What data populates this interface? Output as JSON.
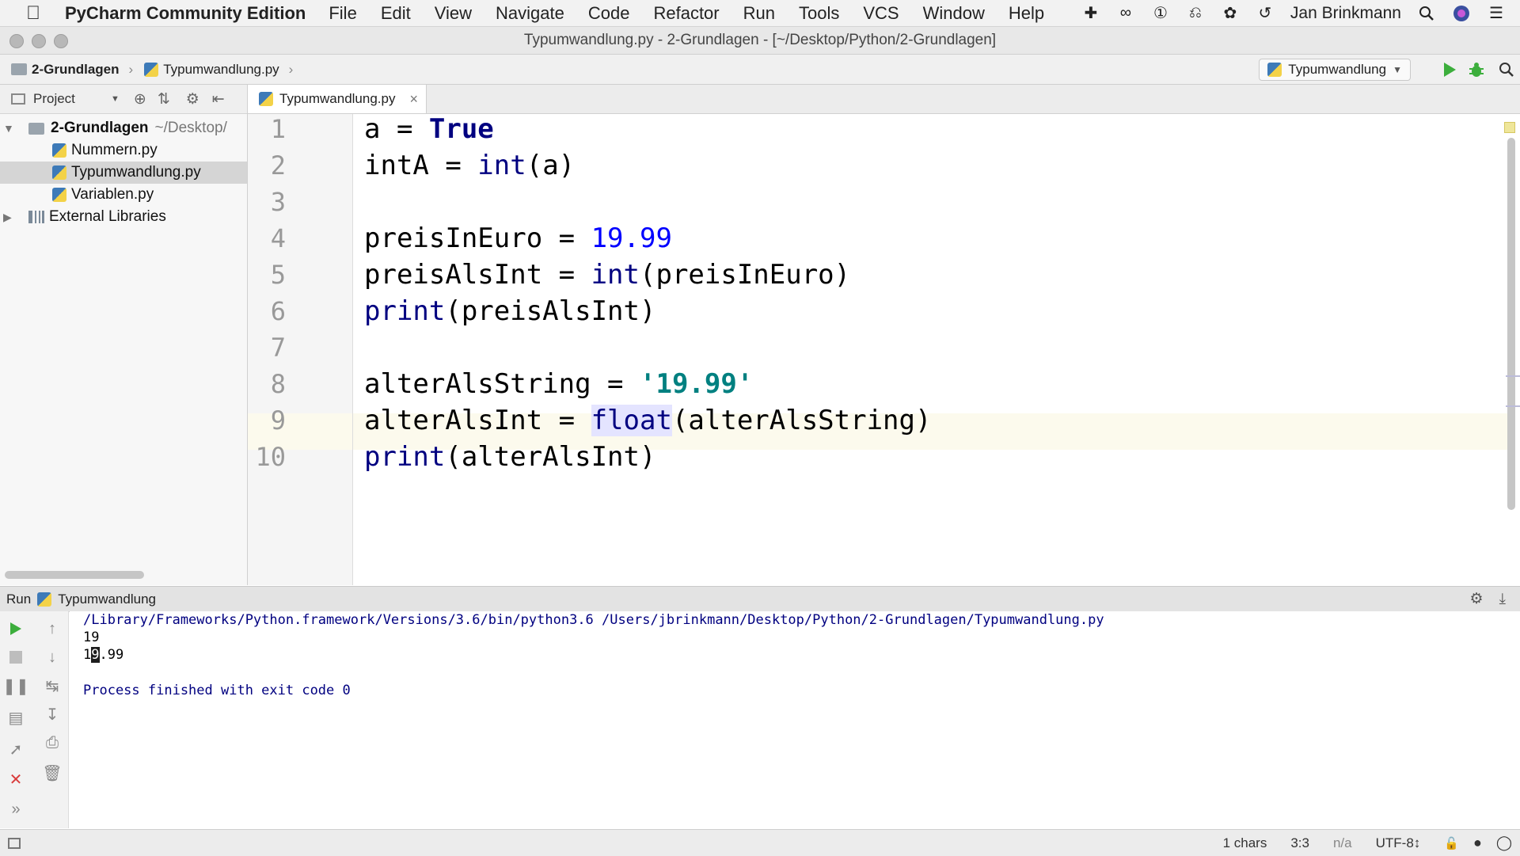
{
  "menubar": {
    "app_name": "PyCharm Community Edition",
    "items": [
      "File",
      "Edit",
      "View",
      "Navigate",
      "Code",
      "Refactor",
      "Run",
      "Tools",
      "VCS",
      "Window",
      "Help"
    ],
    "user": "Jan Brinkmann"
  },
  "window": {
    "title": "Typumwandlung.py - 2-Grundlagen - [~/Desktop/Python/2-Grundlagen]"
  },
  "navbar": {
    "crumb_project": "2-Grundlagen",
    "crumb_file": "Typumwandlung.py",
    "run_config": "Typumwandlung"
  },
  "project_panel": {
    "header_label": "Project",
    "root_name": "2-Grundlagen",
    "root_path": "~/Desktop/",
    "files": [
      "Nummern.py",
      "Typumwandlung.py",
      "Variablen.py"
    ],
    "selected_file": "Typumwandlung.py",
    "external": "External Libraries"
  },
  "editor": {
    "tab_label": "Typumwandlung.py",
    "line_numbers": [
      "1",
      "2",
      "3",
      "4",
      "5",
      "6",
      "7",
      "8",
      "9",
      "10"
    ],
    "current_line": 9,
    "lines": [
      [
        {
          "t": "a = "
        },
        {
          "t": "True",
          "c": "kw"
        }
      ],
      [
        {
          "t": "intA = "
        },
        {
          "t": "int",
          "c": "bi"
        },
        {
          "t": "(a)"
        }
      ],
      [],
      [
        {
          "t": "preisInEuro = "
        },
        {
          "t": "19.99",
          "c": "num"
        }
      ],
      [
        {
          "t": "preisAlsInt = "
        },
        {
          "t": "int",
          "c": "bi"
        },
        {
          "t": "(preisInEuro)"
        }
      ],
      [
        {
          "t": "print",
          "c": "bi"
        },
        {
          "t": "(preisAlsInt)"
        }
      ],
      [],
      [
        {
          "t": "alterAlsString = "
        },
        {
          "t": "'19.99'",
          "c": "str"
        }
      ],
      [
        {
          "t": "alterAlsInt = "
        },
        {
          "t": "float",
          "c": "bi sel"
        },
        {
          "t": "(alterAlsString)"
        }
      ],
      [
        {
          "t": "print",
          "c": "bi"
        },
        {
          "t": "(alterAlsInt)"
        }
      ]
    ]
  },
  "run_panel": {
    "label": "Run",
    "config_name": "Typumwandlung",
    "command": "/Library/Frameworks/Python.framework/Versions/3.6/bin/python3.6 /Users/jbrinkmann/Desktop/Python/2-Grundlagen/Typumwandlung.py",
    "output_1": "19",
    "output_2_pre": "1",
    "output_2_sel": "9",
    "output_2_post": ".99",
    "finish": "Process finished with exit code 0"
  },
  "statusbar": {
    "chars": "1 chars",
    "position": "3:3",
    "na": "n/a",
    "encoding": "UTF-8↕"
  },
  "icons": {
    "run_color": "#3cae3c",
    "stop_color": "#d93c3c",
    "folder_color": "#9aa4ad"
  }
}
